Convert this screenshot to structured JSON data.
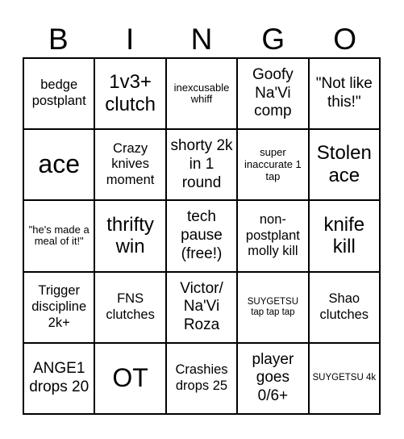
{
  "header": {
    "letters": [
      "B",
      "I",
      "N",
      "G",
      "O"
    ]
  },
  "cells": [
    {
      "text": "bedge postplant",
      "size": "s-md"
    },
    {
      "text": "1v3+ clutch",
      "size": "s-xl"
    },
    {
      "text": "inexcusable whiff",
      "size": "s-sm"
    },
    {
      "text": "Goofy Na'Vi comp",
      "size": "s-lg"
    },
    {
      "text": "\"Not like this!\"",
      "size": "s-lg"
    },
    {
      "text": "ace",
      "size": "s-xxl"
    },
    {
      "text": "Crazy knives moment",
      "size": "s-md"
    },
    {
      "text": "shorty 2k in 1 round",
      "size": "s-lg"
    },
    {
      "text": "super inaccurate 1 tap",
      "size": "s-sm"
    },
    {
      "text": "Stolen ace",
      "size": "s-xl"
    },
    {
      "text": "\"he's made a meal of it!\"",
      "size": "s-sm"
    },
    {
      "text": "thrifty win",
      "size": "s-xl"
    },
    {
      "text": "tech pause (free!)",
      "size": "s-lg"
    },
    {
      "text": "non-postplant molly kill",
      "size": "s-md"
    },
    {
      "text": "knife kill",
      "size": "s-xl"
    },
    {
      "text": "Trigger discipline 2k+",
      "size": "s-md"
    },
    {
      "text": "FNS clutches",
      "size": "s-md"
    },
    {
      "text": "Victor/ Na'Vi Roza",
      "size": "s-lg"
    },
    {
      "text": "SUYGETSU tap tap tap",
      "size": "s-xs"
    },
    {
      "text": "Shao clutches",
      "size": "s-md"
    },
    {
      "text": "ANGE1 drops 20",
      "size": "s-lg"
    },
    {
      "text": "OT",
      "size": "s-xxl"
    },
    {
      "text": "Crashies drops 25",
      "size": "s-md"
    },
    {
      "text": "player goes 0/6+",
      "size": "s-lg"
    },
    {
      "text": "SUYGETSU 4k",
      "size": "s-xs"
    }
  ]
}
